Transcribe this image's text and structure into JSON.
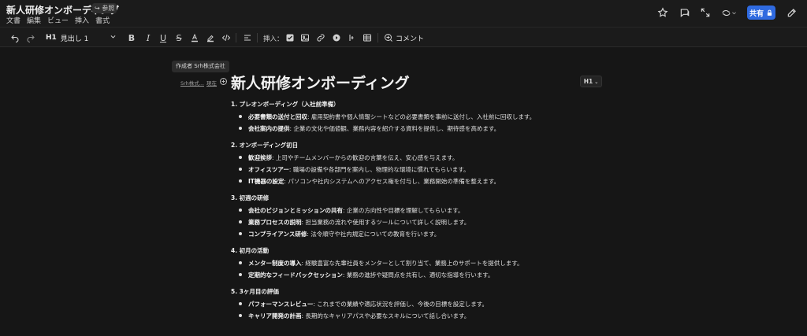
{
  "app": {
    "doc_title": "新人研修オンボーディング",
    "ref_badge": "↪ 参照",
    "menus": [
      "文書",
      "編集",
      "ビュー",
      "挿入",
      "書式"
    ],
    "share_label": "共有",
    "icons": [
      "star-icon",
      "comment-bubble-icon",
      "expand-icon",
      "sync-icon",
      "edit-icon",
      "lock-icon"
    ]
  },
  "toolbar": {
    "heading_tag": "H1",
    "style_label": "見出し 1",
    "insert_label": "挿入：",
    "comment_label": "コメント",
    "format_glyphs": {
      "bold": "B",
      "italic": "I",
      "underline": "U",
      "strike": "S"
    }
  },
  "document": {
    "author_tooltip": "作成者 Srh株式会社",
    "author_links": [
      "Srh株式...",
      "現在"
    ],
    "heading_badge": "H1",
    "title": "新人研修オンボーディング",
    "sections": [
      {
        "heading": "1. プレオンボーディング（入社前準備）",
        "items": [
          {
            "term": "必要書類の送付と回収",
            "desc": ": 雇用契約書や個人情報シートなどの必要書類を事前に送付し、入社前に回収します。"
          },
          {
            "term": "会社案内の提供",
            "desc": ": 企業の文化や価値観、業務内容を紹介する資料を提供し、期待感を高めます。"
          }
        ]
      },
      {
        "heading": "2. オンボーディング初日",
        "items": [
          {
            "term": "歓迎挨拶",
            "desc": ": 上司やチームメンバーからの歓迎の言葉を伝え、安心感を与えます。"
          },
          {
            "term": "オフィスツアー",
            "desc": ": 職場の設備や各部門を案内し、物理的な環境に慣れてもらいます。"
          },
          {
            "term": "IT機器の設定",
            "desc": ": パソコンや社内システムへのアクセス権を付与し、業務開始の準備を整えます。"
          }
        ]
      },
      {
        "heading": "3. 初週の研修",
        "items": [
          {
            "term": "会社のビジョンとミッションの共有",
            "desc": ": 企業の方向性や目標を理解してもらいます。"
          },
          {
            "term": "業務プロセスの説明",
            "desc": ": 担当業務の流れや使用するツールについて詳しく説明します。"
          },
          {
            "term": "コンプライアンス研修",
            "desc": ": 法令順守や社内規定についての教育を行います。"
          }
        ]
      },
      {
        "heading": "4. 初月の活動",
        "items": [
          {
            "term": "メンター制度の導入",
            "desc": ": 経験豊富な先輩社員をメンターとして割り当て、業務上のサポートを提供します。"
          },
          {
            "term": "定期的なフィードバックセッション",
            "desc": ": 業務の進捗や疑問点を共有し、適切な指導を行います。"
          }
        ]
      },
      {
        "heading": "5. 3ヶ月目の評価",
        "items": [
          {
            "term": "パフォーマンスレビュー",
            "desc": ": これまでの業績や適応状況を評価し、今後の目標を設定します。"
          },
          {
            "term": "キャリア開発の計画",
            "desc": ": 長期的なキャリアパスや必要なスキルについて話し合います。"
          }
        ]
      }
    ]
  }
}
